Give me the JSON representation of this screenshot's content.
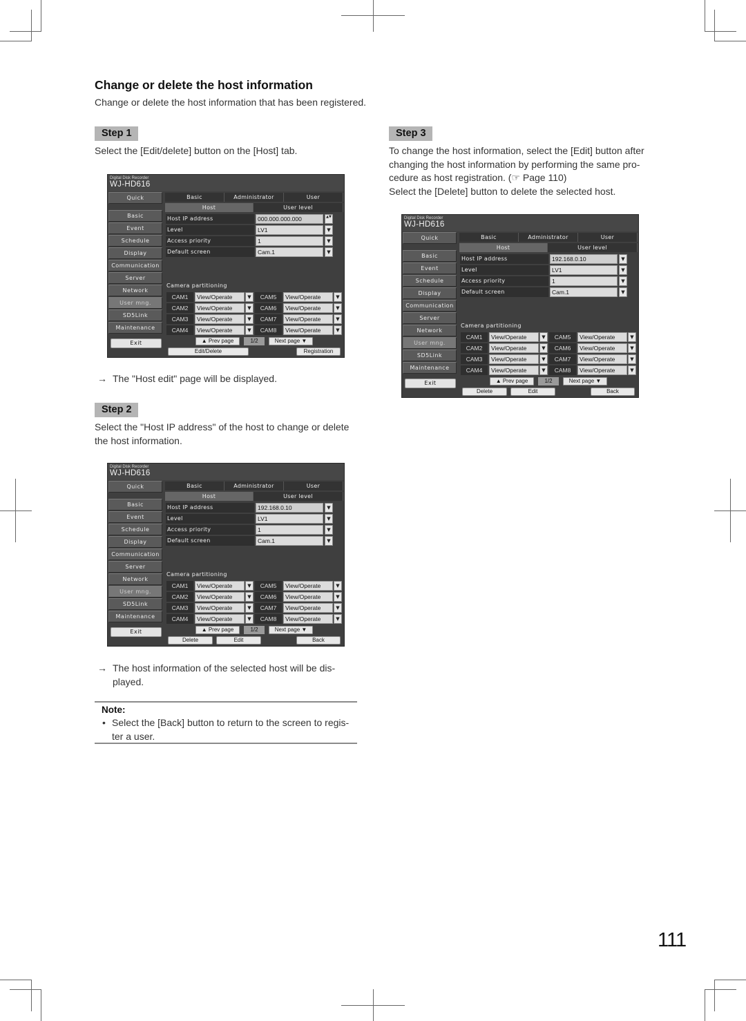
{
  "page": {
    "title": "Change or delete the host information",
    "intro": "Change or delete the host information that has been registered.",
    "page_number": "111"
  },
  "steps": [
    {
      "badge": "Step 1",
      "text": "Select the [Edit/delete] button on the [Host] tab.",
      "result": "The \"Host edit\" page will be displayed."
    },
    {
      "badge": "Step 2",
      "text_line1": "Select the \"Host IP address\" of the host to change or delete",
      "text_line2": "the host information.",
      "result_line1": "The host information of the selected host will be dis-",
      "result_line2": "played."
    },
    {
      "badge": "Step 3",
      "text_line1": "To change the host information, select the [Edit] button after",
      "text_line2": "changing the host information by performing the same pro-",
      "text_line3": "cedure as host registration. (☞ Page 110)",
      "text_line4": "Select the [Delete] button to delete the selected host."
    }
  ],
  "arrow_glyph": "→",
  "note": {
    "title": "Note:",
    "bullet": "•",
    "line1": "Select the [Back] button to return to the screen to regis-",
    "line2": "ter a user."
  },
  "screens": [
    {
      "brand_small": "Digital Disk Recorder",
      "brand_model": "WJ-HD616",
      "sidebar": [
        "Quick",
        "Basic",
        "Event",
        "Schedule",
        "Display",
        "Communication",
        "Server",
        "Network",
        "User mng.",
        "SD5Link",
        "Maintenance"
      ],
      "exit": "Exit",
      "tabs": [
        "Basic",
        "Administrator",
        "User"
      ],
      "subtabs": [
        "Host",
        "User level"
      ],
      "fields": [
        {
          "label": "Host IP address",
          "value": "000.000.000.000",
          "control": "spin-icon"
        },
        {
          "label": "Level",
          "value": "LV1",
          "control": "dropdown-icon"
        },
        {
          "label": "Access priority",
          "value": "1",
          "control": "dropdown-icon"
        },
        {
          "label": "Default screen",
          "value": "Cam.1",
          "control": "dropdown-icon"
        }
      ],
      "cam_title": "Camera partitioning",
      "cams": [
        {
          "label": "CAM1",
          "value": "View/Operate"
        },
        {
          "label": "CAM2",
          "value": "View/Operate"
        },
        {
          "label": "CAM3",
          "value": "View/Operate"
        },
        {
          "label": "CAM4",
          "value": "View/Operate"
        },
        {
          "label": "CAM5",
          "value": "View/Operate"
        },
        {
          "label": "CAM6",
          "value": "View/Operate"
        },
        {
          "label": "CAM7",
          "value": "View/Operate"
        },
        {
          "label": "CAM8",
          "value": "View/Operate"
        }
      ],
      "prev": "▲  Prev page",
      "page": "1/2",
      "next": "Next page  ▼",
      "actions": [
        "Edit/Delete",
        "Registration"
      ]
    },
    {
      "brand_small": "Digital Disk Recorder",
      "brand_model": "WJ-HD616",
      "sidebar": [
        "Quick",
        "Basic",
        "Event",
        "Schedule",
        "Display",
        "Communication",
        "Server",
        "Network",
        "User mng.",
        "SD5Link",
        "Maintenance"
      ],
      "exit": "Exit",
      "tabs": [
        "Basic",
        "Administrator",
        "User"
      ],
      "subtabs": [
        "Host",
        "User level"
      ],
      "fields": [
        {
          "label": "Host IP address",
          "value": "192.168.0.10",
          "control": "dropdown-icon"
        },
        {
          "label": "Level",
          "value": "LV1",
          "control": "dropdown-icon"
        },
        {
          "label": "Access priority",
          "value": "1",
          "control": "dropdown-icon"
        },
        {
          "label": "Default screen",
          "value": "Cam.1",
          "control": "dropdown-icon"
        }
      ],
      "cam_title": "Camera partitioning",
      "cams": [
        {
          "label": "CAM1",
          "value": "View/Operate"
        },
        {
          "label": "CAM2",
          "value": "View/Operate"
        },
        {
          "label": "CAM3",
          "value": "View/Operate"
        },
        {
          "label": "CAM4",
          "value": "View/Operate"
        },
        {
          "label": "CAM5",
          "value": "View/Operate"
        },
        {
          "label": "CAM6",
          "value": "View/Operate"
        },
        {
          "label": "CAM7",
          "value": "View/Operate"
        },
        {
          "label": "CAM8",
          "value": "View/Operate"
        }
      ],
      "prev": "▲  Prev page",
      "page": "1/2",
      "next": "Next page  ▼",
      "actions": [
        "Delete",
        "Edit",
        "Back"
      ]
    },
    {
      "brand_small": "Digital Disk Recorder",
      "brand_model": "WJ-HD616",
      "sidebar": [
        "Quick",
        "Basic",
        "Event",
        "Schedule",
        "Display",
        "Communication",
        "Server",
        "Network",
        "User mng.",
        "SD5Link",
        "Maintenance"
      ],
      "exit": "Exit",
      "tabs": [
        "Basic",
        "Administrator",
        "User"
      ],
      "subtabs": [
        "Host",
        "User level"
      ],
      "fields": [
        {
          "label": "Host IP address",
          "value": "192.168.0.10",
          "control": "dropdown-icon"
        },
        {
          "label": "Level",
          "value": "LV1",
          "control": "dropdown-icon"
        },
        {
          "label": "Access priority",
          "value": "1",
          "control": "dropdown-icon"
        },
        {
          "label": "Default screen",
          "value": "Cam.1",
          "control": "dropdown-icon"
        }
      ],
      "cam_title": "Camera partitioning",
      "cams": [
        {
          "label": "CAM1",
          "value": "View/Operate"
        },
        {
          "label": "CAM2",
          "value": "View/Operate"
        },
        {
          "label": "CAM3",
          "value": "View/Operate"
        },
        {
          "label": "CAM4",
          "value": "View/Operate"
        },
        {
          "label": "CAM5",
          "value": "View/Operate"
        },
        {
          "label": "CAM6",
          "value": "View/Operate"
        },
        {
          "label": "CAM7",
          "value": "View/Operate"
        },
        {
          "label": "CAM8",
          "value": "View/Operate"
        }
      ],
      "prev": "▲  Prev page",
      "page": "1/2",
      "next": "Next page  ▼",
      "actions": [
        "Delete",
        "Edit",
        "Back"
      ]
    }
  ],
  "icons": {
    "dropdown": "▼",
    "spin": "▲▼"
  }
}
